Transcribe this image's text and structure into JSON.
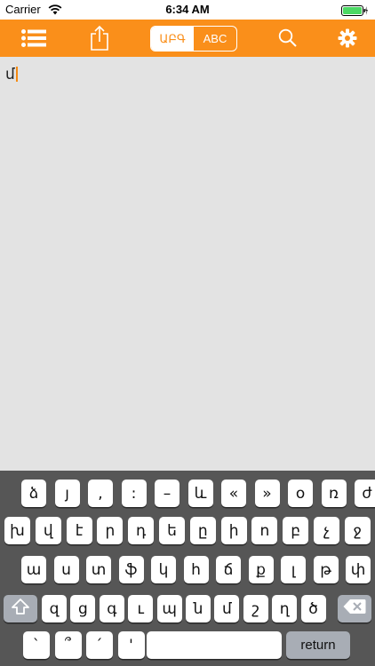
{
  "status_bar": {
    "carrier": "Carrier",
    "time": "6:34 AM"
  },
  "toolbar": {
    "menu_icon": "list-icon",
    "share_icon": "share-icon",
    "search_icon": "search-icon",
    "settings_icon": "gear-icon",
    "segment": {
      "armenian": "ԱԲԳ",
      "latin": "ABC",
      "selected": "armenian"
    },
    "accent_color": "#fa8f1a"
  },
  "editor": {
    "text": "մ"
  },
  "keyboard": {
    "row1": [
      "ձ",
      "յ",
      ",",
      ":",
      "–",
      "և",
      "«",
      "»",
      "օ",
      "ռ",
      "ժ"
    ],
    "row2": [
      "խ",
      "վ",
      "է",
      "ր",
      "դ",
      "ե",
      "ը",
      "ի",
      "ո",
      "բ",
      "չ",
      "ջ"
    ],
    "row3": [
      "ա",
      "ս",
      "տ",
      "ֆ",
      "կ",
      "հ",
      "ճ",
      "ք",
      "լ",
      "թ",
      "փ"
    ],
    "row4": [
      "զ",
      "ց",
      "գ",
      "ւ",
      "պ",
      "ն",
      "մ",
      "շ",
      "ղ",
      "ծ"
    ],
    "row5": [
      "`",
      "՞",
      "՛",
      "'"
    ],
    "shift_icon": "shift-icon",
    "backspace_icon": "backspace-icon",
    "space_label": "",
    "return_label": "return"
  }
}
